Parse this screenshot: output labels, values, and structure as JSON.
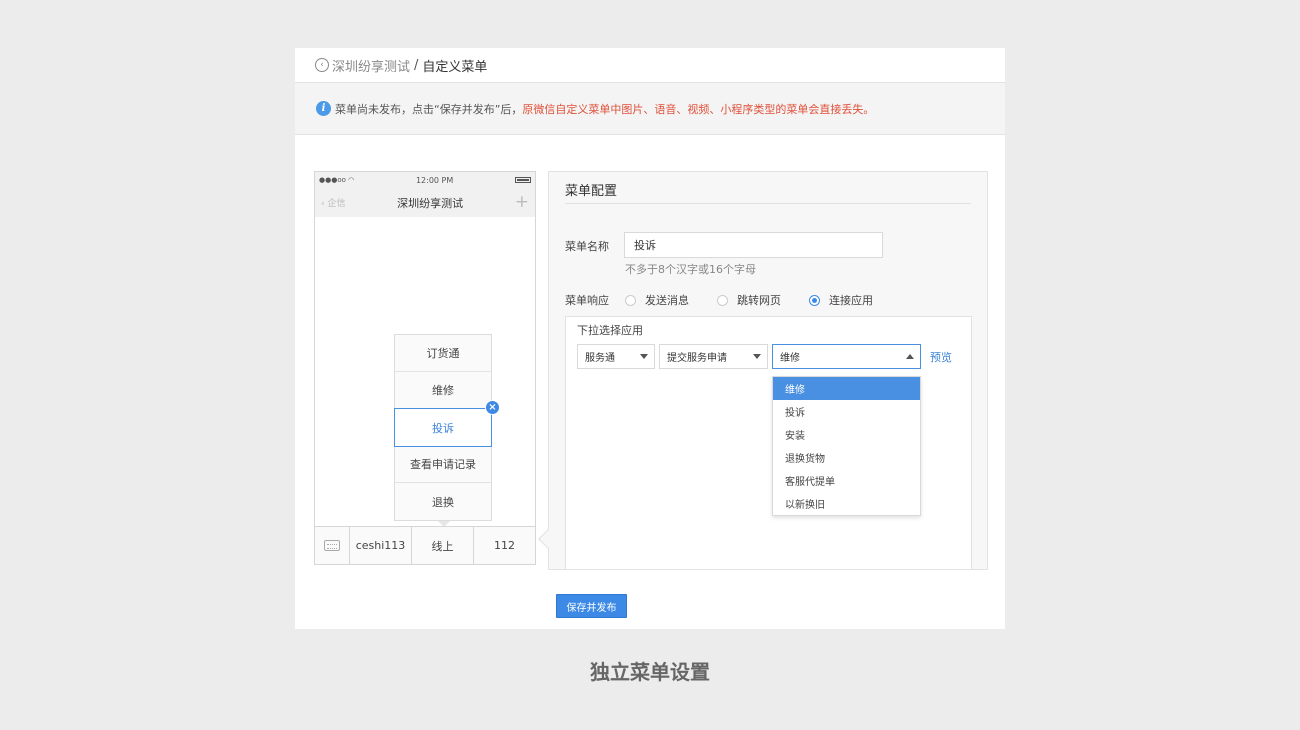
{
  "breadcrumb": {
    "back_icon": "chevron-left-circle-icon",
    "parent": "深圳纷享测试",
    "separator": "/",
    "current": "自定义菜单"
  },
  "notice": {
    "icon": "info-icon",
    "text": "菜单尚未发布，点击“保存并发布”后，",
    "warning": "原微信自定义菜单中图片、语音、视频、小程序类型的菜单会直接丢失。",
    "warning_color": "#e0503a"
  },
  "phone": {
    "status": {
      "signal": "●●●oo",
      "time": "12:00 PM"
    },
    "nav": {
      "back": "企信",
      "title": "深圳纷享测试",
      "plus": "+"
    },
    "submenu": [
      "订货通",
      "维修",
      "投诉",
      "查看申请记录",
      "退换"
    ],
    "active_submenu_index": 2,
    "close_badge": "×",
    "bottom_menu": [
      "ceshi113",
      "线上",
      "112"
    ]
  },
  "config": {
    "title": "菜单配置",
    "name_label": "菜单名称",
    "name_value": "投诉",
    "name_hint": "不多于8个汉字或16个字母",
    "response_label": "菜单响应",
    "response_options": [
      "发送消息",
      "跳转网页",
      "连接应用"
    ],
    "response_selected_index": 2,
    "app_box_title": "下拉选择应用",
    "selects": [
      "服务通",
      "提交服务申请",
      "维修"
    ],
    "preview": "预览",
    "dropdown_options": [
      "维修",
      "投诉",
      "安装",
      "退换货物",
      "客服代提单",
      "以新换旧"
    ],
    "dropdown_highlight_index": 0
  },
  "save_button": "保存并发布",
  "caption": "独立菜单设置",
  "colors": {
    "accent": "#3d8ae6",
    "background": "#ececec"
  }
}
